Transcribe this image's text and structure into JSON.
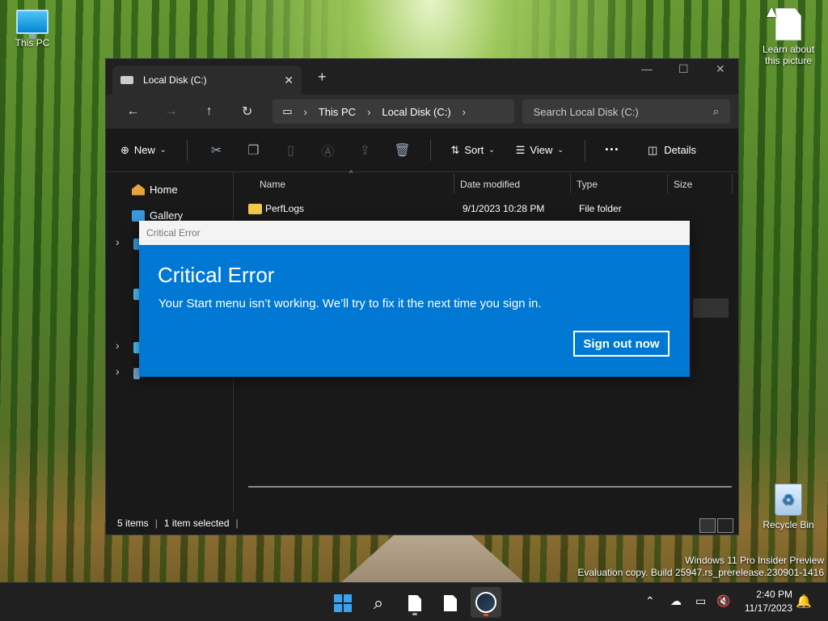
{
  "desktop": {
    "icons": [
      {
        "label": "This PC"
      },
      {
        "label": "Learn about this picture"
      },
      {
        "label": "Recycle Bin"
      }
    ],
    "watermark": {
      "line1": "Windows 11 Pro Insider Preview",
      "line2": "Evaluation copy. Build 25947.rs_prerelease.230901-1416"
    }
  },
  "explorer": {
    "tab_title": "Local Disk (C:)",
    "breadcrumb": [
      "This PC",
      "Local Disk (C:)"
    ],
    "search_placeholder": "Search Local Disk (C:)",
    "commands": {
      "new": "New",
      "sort": "Sort",
      "view": "View",
      "details": "Details"
    },
    "nav_items": [
      {
        "label": "Home",
        "icon": "home-icon"
      },
      {
        "label": "Gallery",
        "icon": "gallery-icon"
      }
    ],
    "columns": [
      "Name",
      "Date modified",
      "Type",
      "Size"
    ],
    "rows": [
      {
        "name": "PerfLogs",
        "date": "9/1/2023 10:28 PM",
        "type": "File folder",
        "size": ""
      }
    ],
    "status": {
      "items": "5 items",
      "selected": "1 item selected"
    }
  },
  "dialog": {
    "window_title": "Critical Error",
    "heading": "Critical Error",
    "message": "Your Start menu isn’t working. We’ll try to fix it the next time you sign in.",
    "button": "Sign out now"
  },
  "taskbar": {
    "time": "2:40 PM",
    "date": "11/17/2023"
  },
  "colors": {
    "accent": "#0078d4",
    "folder": "#f4c84a",
    "taskbar": "#202020"
  }
}
